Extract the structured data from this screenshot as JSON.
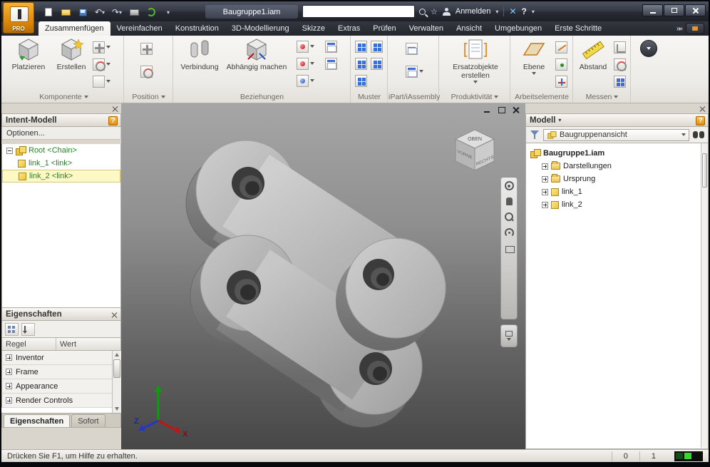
{
  "titlebar": {
    "app_button_label": "PRO",
    "document_title": "Baugruppe1.iam",
    "search_value": "",
    "signin_label": "Anmelden"
  },
  "ribbon": {
    "tabs": [
      "Zusammenfügen",
      "Vereinfachen",
      "Konstruktion",
      "3D-Modellierung",
      "Skizze",
      "Extras",
      "Prüfen",
      "Verwalten",
      "Ansicht",
      "Umgebungen",
      "Erste Schritte"
    ],
    "active_tab": "Zusammenfügen",
    "buttons": {
      "platzieren": "Platzieren",
      "erstellen": "Erstellen",
      "verbindung": "Verbindung",
      "abhaengig_machen": "Abhängig machen",
      "ersatzobjekte": "Ersatzobjekte erstellen",
      "ebene": "Ebene",
      "abstand": "Abstand"
    },
    "panels": [
      "Komponente",
      "Position",
      "Beziehungen",
      "Muster",
      "iPart/iAssembly",
      "Produktivität",
      "Arbeitselemente",
      "Messen"
    ]
  },
  "intent_panel": {
    "title": "Intent-Modell",
    "options": "Optionen...",
    "tree": {
      "root": "Root <Chain>",
      "child1": "link_1 <link>",
      "child2": "link_2 <link>"
    }
  },
  "properties_panel": {
    "title": "Eigenschaften",
    "col_rule": "Regel",
    "col_value": "Wert",
    "rows": [
      "Inventor",
      "Frame",
      "Appearance",
      "Render Controls"
    ],
    "tab_properties": "Eigenschaften",
    "tab_instant": "Sofort"
  },
  "model_panel": {
    "title": "Modell",
    "view_mode": "Baugruppenansicht",
    "root": "Baugruppe1.iam",
    "nodes": [
      "Darstellungen",
      "Ursprung",
      "link_1",
      "link_2"
    ]
  },
  "viewport": {
    "viewcube_top": "OBEN",
    "viewcube_front": "VORNE",
    "viewcube_right": "RECHTS",
    "axis_x": "X",
    "axis_z": "Z"
  },
  "statusbar": {
    "help_text": "Drücken Sie F1, um Hilfe zu erhalten.",
    "counter_a": "0",
    "counter_b": "1"
  }
}
